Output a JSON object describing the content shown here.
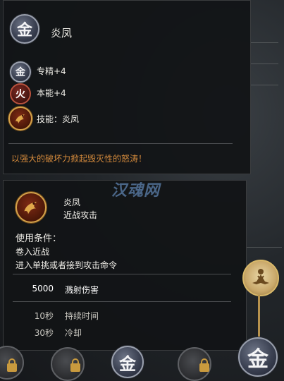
{
  "item": {
    "element_glyph": "金",
    "name": "炎凤"
  },
  "attributes": [
    {
      "glyph": "金",
      "text": "专精+4"
    },
    {
      "glyph": "火",
      "text": "本能+4"
    },
    {
      "glyph": "",
      "text": "技能：炎凤"
    }
  ],
  "description": "以强大的破坏力掀起毁灭性的怒涛！",
  "skill": {
    "name": "炎凤",
    "type": "近战攻击",
    "conditions_title": "使用条件：",
    "conditions": [
      "卷入近战",
      "进入单挑或者接到攻击命令"
    ],
    "stats": [
      {
        "value": "5000",
        "label": "溅射伤害",
        "emphasis": true
      },
      {
        "value": "10秒",
        "label": "持续时间",
        "emphasis": false
      },
      {
        "value": "30秒",
        "label": "冷却",
        "emphasis": false
      }
    ]
  },
  "watermark": "汉魂网",
  "bottom_bar": {
    "metal_glyph": "金"
  },
  "colors": {
    "description": "#d48a3c",
    "stat_emphasis": "#ffffff",
    "stat_muted": "#c9c7c0",
    "gold": "#c99a3e"
  }
}
